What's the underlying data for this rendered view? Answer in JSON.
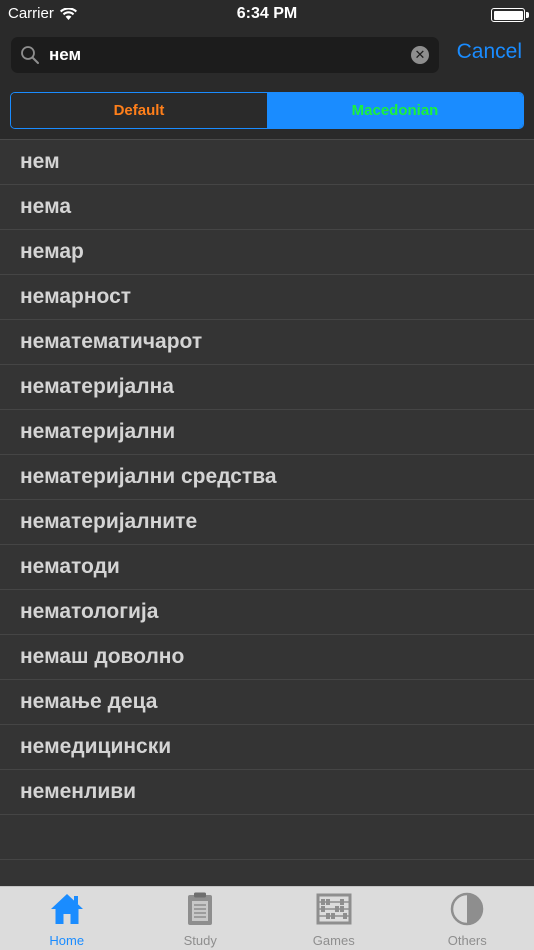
{
  "status_bar": {
    "carrier": "Carrier",
    "time": "6:34 PM",
    "battery_level": 1.0
  },
  "search": {
    "value": "нем",
    "cancel_label": "Cancel",
    "icon": "search-icon",
    "clear_icon": "clear-icon"
  },
  "segmented_control": {
    "options": [
      "Default",
      "Macedonian"
    ],
    "selected": "Macedonian"
  },
  "results": [
    "нем",
    "нема",
    "немар",
    "немарност",
    "нематематичарот",
    "нематеријална",
    "нематеријални",
    "нематеријални средства",
    "нематеријалните",
    "нематоди",
    "нематологија",
    "немаш доволно",
    "немање деца",
    "немедицински",
    "неменливи"
  ],
  "tab_bar": {
    "tabs": [
      {
        "label": "Home",
        "icon": "home-icon",
        "active": true
      },
      {
        "label": "Study",
        "icon": "clipboard-icon",
        "active": false
      },
      {
        "label": "Games",
        "icon": "abacus-icon",
        "active": false
      },
      {
        "label": "Others",
        "icon": "half-circle-icon",
        "active": false
      }
    ]
  },
  "colors": {
    "accent": "#1a8cff",
    "default_segment_text": "#ff7f1a",
    "selected_segment_text": "#1bf23c",
    "background": "#343434",
    "row_text": "#d4d4d4"
  }
}
